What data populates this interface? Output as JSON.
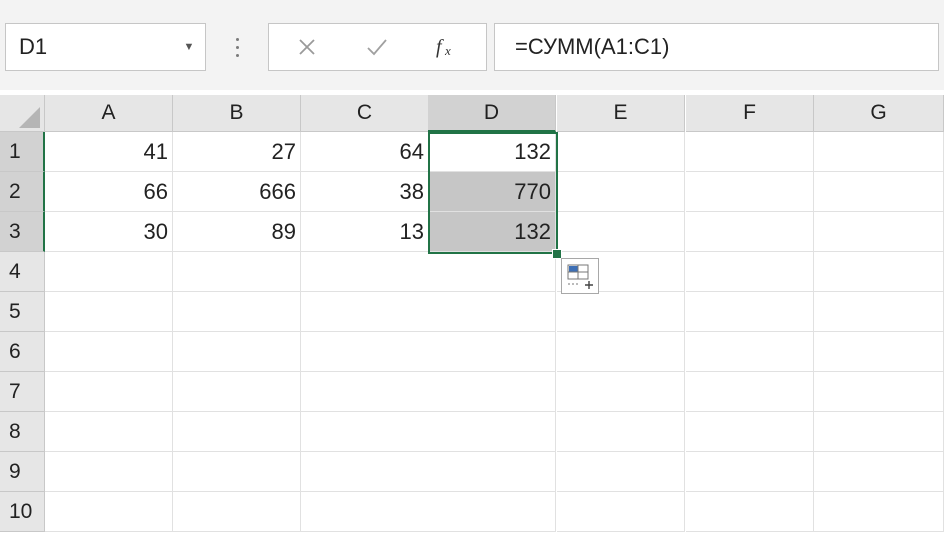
{
  "name_box": {
    "value": "D1",
    "dropdown_icon": "chevron-down-icon"
  },
  "formula_bar": {
    "cancel_icon": "cancel-x-icon",
    "enter_icon": "checkmark-icon",
    "fx_icon": "insert-function-icon",
    "formula": "=СУММ(A1:C1)"
  },
  "sheet": {
    "columns": [
      "A",
      "B",
      "C",
      "D",
      "E",
      "F",
      "G"
    ],
    "selected_column": "D",
    "rows": [
      "1",
      "2",
      "3",
      "4",
      "5",
      "6",
      "7",
      "8",
      "9",
      "10"
    ],
    "selected_rows": [
      "1",
      "2",
      "3"
    ],
    "cells": {
      "A1": "41",
      "B1": "27",
      "C1": "64",
      "D1": "132",
      "A2": "66",
      "B2": "666",
      "C2": "38",
      "D2": "770",
      "A3": "30",
      "B3": "89",
      "C3": "13",
      "D3": "132"
    },
    "selection": "D1:D3",
    "selection_color": "#217346",
    "quick_analysis_icon": "quick-analysis-icon"
  }
}
